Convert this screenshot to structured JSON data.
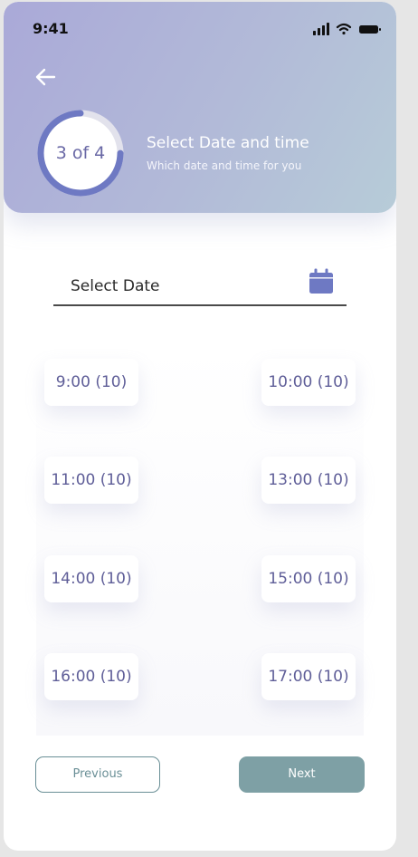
{
  "status_bar": {
    "time": "9:41",
    "icons": [
      "signal-icon",
      "wifi-icon",
      "battery-icon"
    ]
  },
  "header": {
    "back_icon": "arrow-left-icon",
    "progress": {
      "label": "3 of 4",
      "current": 3,
      "total": 4,
      "fraction": 0.75
    },
    "title": "Select Date and time",
    "subtitle": "Which date and time for you"
  },
  "date_field": {
    "label": "Select Date",
    "icon": "calendar-icon"
  },
  "time_slots": [
    "9:00 (10)",
    "10:00 (10)",
    "11:00 (10)",
    "13:00 (10)",
    "14:00 (10)",
    "15:00 (10)",
    "16:00 (10)",
    "17:00 (10)"
  ],
  "buttons": {
    "previous": "Previous",
    "next": "Next"
  },
  "colors": {
    "header_gradient_start": "#aaa9d8",
    "header_gradient_end": "#b7ccd8",
    "progress_accent": "#6e79c3",
    "slot_text": "#5f5e98",
    "next_button": "#7ea0a5",
    "previous_border": "#6a8f96"
  }
}
